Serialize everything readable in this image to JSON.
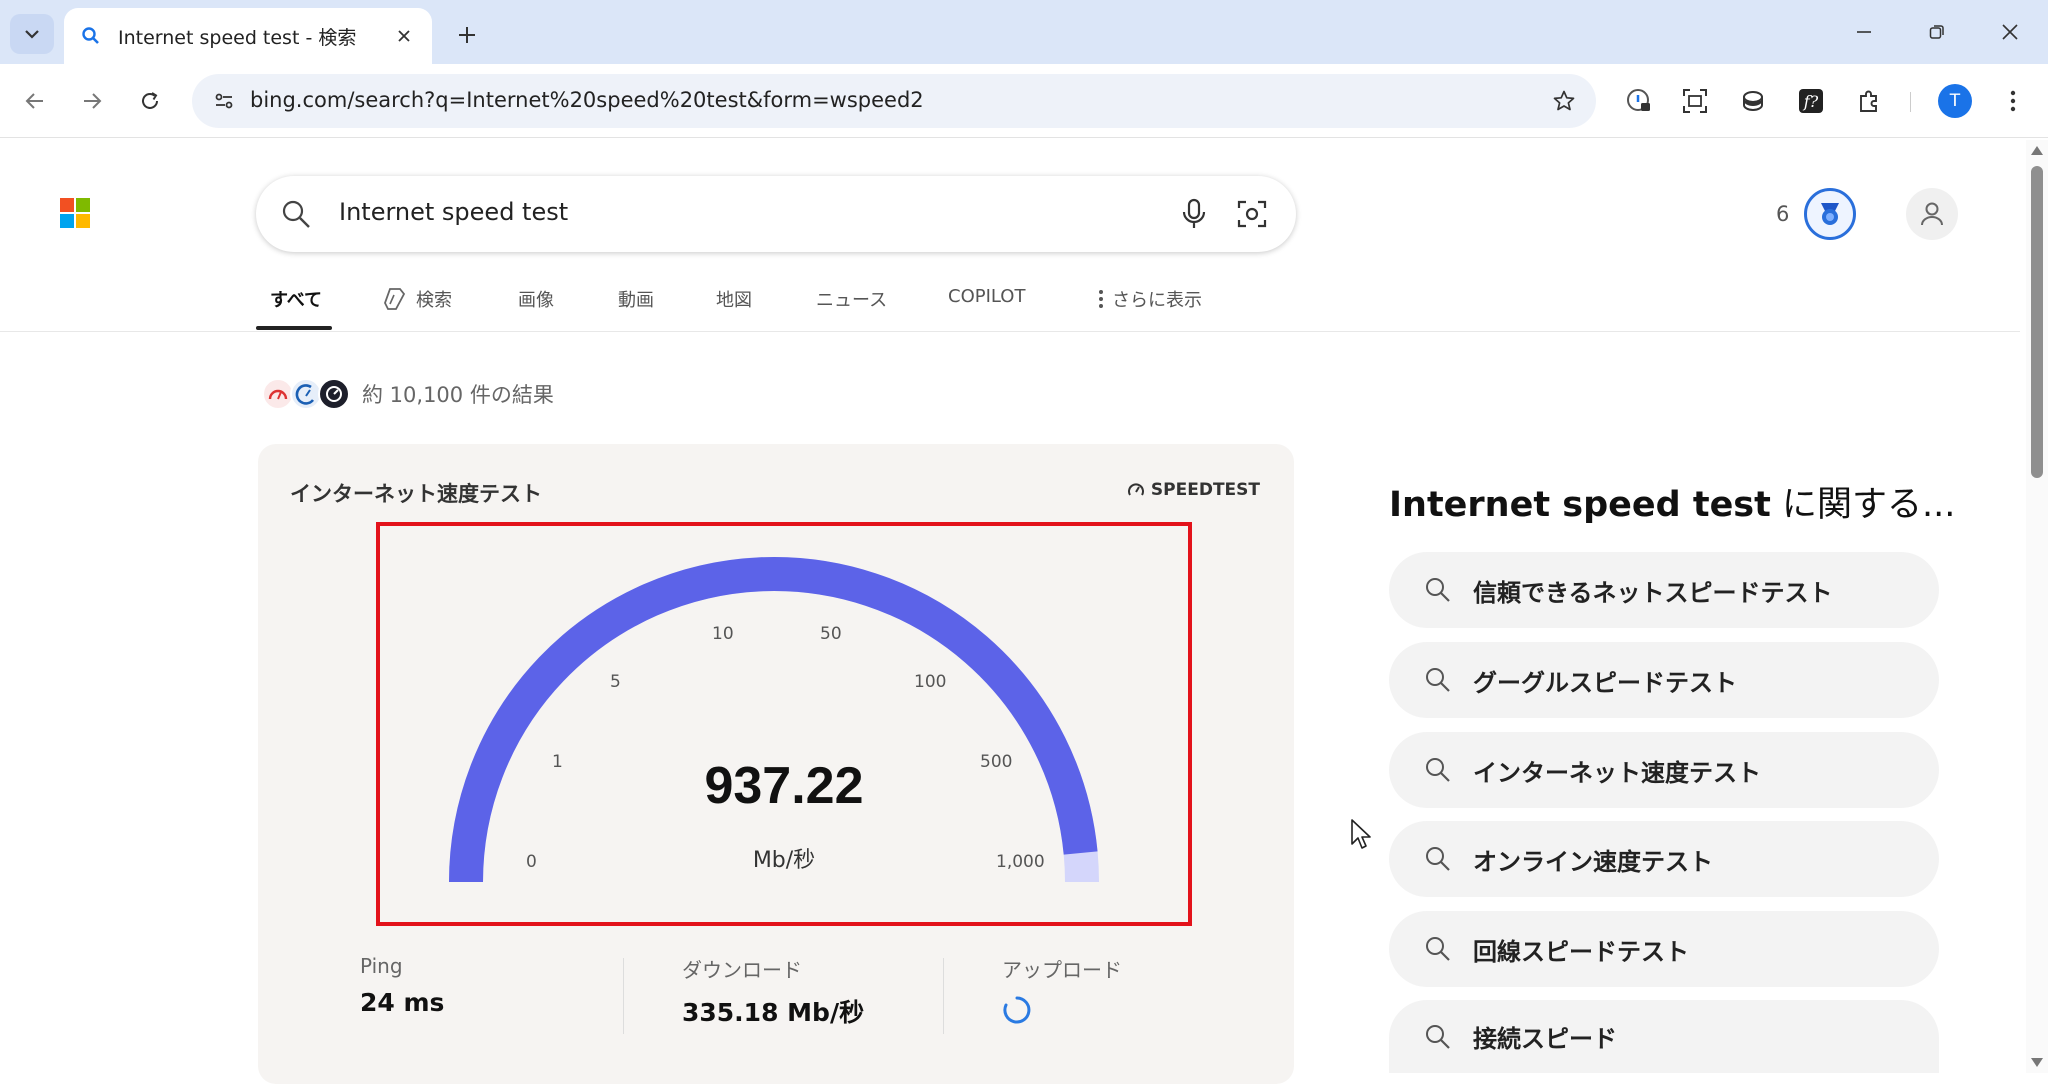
{
  "browser": {
    "tab_title": "Internet speed test - 検索",
    "url": "bing.com/search?q=Internet%20speed%20test&form=wspeed2",
    "profile_initial": "T"
  },
  "bing": {
    "search_query": "Internet speed test",
    "rewards_count": "6",
    "nav_tabs": [
      {
        "label": "すべて"
      },
      {
        "label": "検索"
      },
      {
        "label": "画像"
      },
      {
        "label": "動画"
      },
      {
        "label": "地図"
      },
      {
        "label": "ニュース"
      },
      {
        "label": "COPILOT"
      },
      {
        "label": "さらに表示"
      }
    ],
    "results_count": "約 10,100 件の結果"
  },
  "speedtest": {
    "title": "インターネット速度テスト",
    "brand": "SPEEDTEST",
    "speed_value": "937.22",
    "unit": "Mb/秒",
    "scale_ticks": [
      "0",
      "1",
      "5",
      "10",
      "50",
      "100",
      "500",
      "1,000"
    ],
    "gauge_fill_fraction": 0.97,
    "stats": {
      "ping_label": "Ping",
      "ping_value": "24 ms",
      "download_label": "ダウンロード",
      "download_value": "335.18 Mb/秒",
      "upload_label": "アップロード"
    },
    "colors": {
      "gauge": "#5c63e8",
      "gauge_track": "#d4d6fb",
      "highlight_frame": "#e3121b"
    }
  },
  "related": {
    "title_query": "Internet speed test",
    "title_suffix": " に関する...",
    "items": [
      "信頼できるネットスピードテスト",
      "グーグルスピードテスト",
      "インターネット速度テスト",
      "オンライン速度テスト",
      "回線スピードテスト",
      "接続スピード"
    ]
  }
}
